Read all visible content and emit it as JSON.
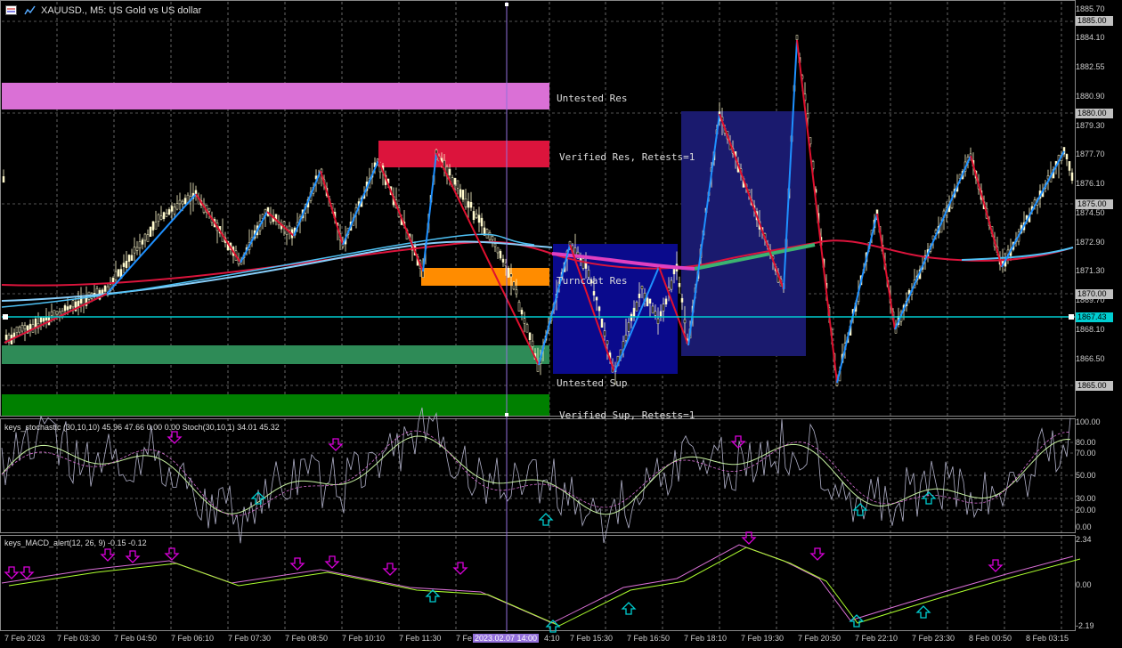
{
  "header": {
    "symbol_title": "XAUUSD., M5:  US Gold vs US dollar"
  },
  "zones": [
    {
      "label": "Untested Res",
      "color": "#da70d6"
    },
    {
      "label": "Verified Res, Retests=1",
      "color": "#dc143c"
    },
    {
      "label": "Turncoat Res",
      "color": "#ff8c00"
    },
    {
      "label": "Untested Sup",
      "color": "#2e8b57"
    },
    {
      "label": "Verified Sup, Retests=1",
      "color": "#008000"
    }
  ],
  "price_axis": {
    "labels": [
      "1885.70",
      "1884.10",
      "1882.55",
      "1880.90",
      "1879.30",
      "1877.70",
      "1876.10",
      "1874.50",
      "1872.90",
      "1871.30",
      "1869.70",
      "1868.10",
      "1866.50"
    ],
    "tags": [
      {
        "text": "1885.00",
        "color": "#c0c0c0",
        "textcolor": "#000"
      },
      {
        "text": "1880.00",
        "color": "#c0c0c0",
        "textcolor": "#000"
      },
      {
        "text": "1875.00",
        "color": "#c0c0c0",
        "textcolor": "#000"
      },
      {
        "text": "1870.00",
        "color": "#c0c0c0",
        "textcolor": "#000"
      },
      {
        "text": "1867.43",
        "color": "#00ced1",
        "textcolor": "#000"
      },
      {
        "text": "1865.00",
        "color": "#c0c0c0",
        "textcolor": "#000"
      }
    ]
  },
  "stochastic": {
    "title": "keys_stochastic (30,10,10) 45.96 47.66 0.00 0.00 Stoch(30,10,1) 34.01 45.32",
    "levels": [
      "100.00",
      "80.00",
      "70.00",
      "50.00",
      "30.00",
      "20.00",
      "0.00"
    ]
  },
  "macd": {
    "title": "keys_MACD_alert(12, 26, 9) -0.15 -0.12",
    "levels": [
      "2.34",
      "0.00",
      "-2.19"
    ]
  },
  "time_axis": {
    "labels": [
      "7 Feb 2023",
      "7 Feb 03:30",
      "7 Feb 04:50",
      "7 Feb 06:10",
      "7 Feb 07:30",
      "7 Feb 08:50",
      "7 Feb 10:10",
      "7 Feb 11:30",
      "7 Fe",
      "4:10",
      "7 Feb 15:30",
      "7 Feb 16:50",
      "7 Feb 18:10",
      "7 Feb 19:30",
      "7 Feb 20:50",
      "7 Feb 22:10",
      "7 Feb 23:30",
      "8 Feb 00:50",
      "8 Feb 03:15"
    ],
    "cursor_label": "2023.02.07 14:00"
  },
  "colors": {
    "background": "#000000",
    "grid": "#c0c0c0",
    "bull_candle": "#ffffe0",
    "zigzag_up": "#1e90ff",
    "zigzag_down": "#e0102f",
    "cursor": "#9370db",
    "box": "#1a1a7a",
    "box_dark": "#0a0a8c"
  }
}
